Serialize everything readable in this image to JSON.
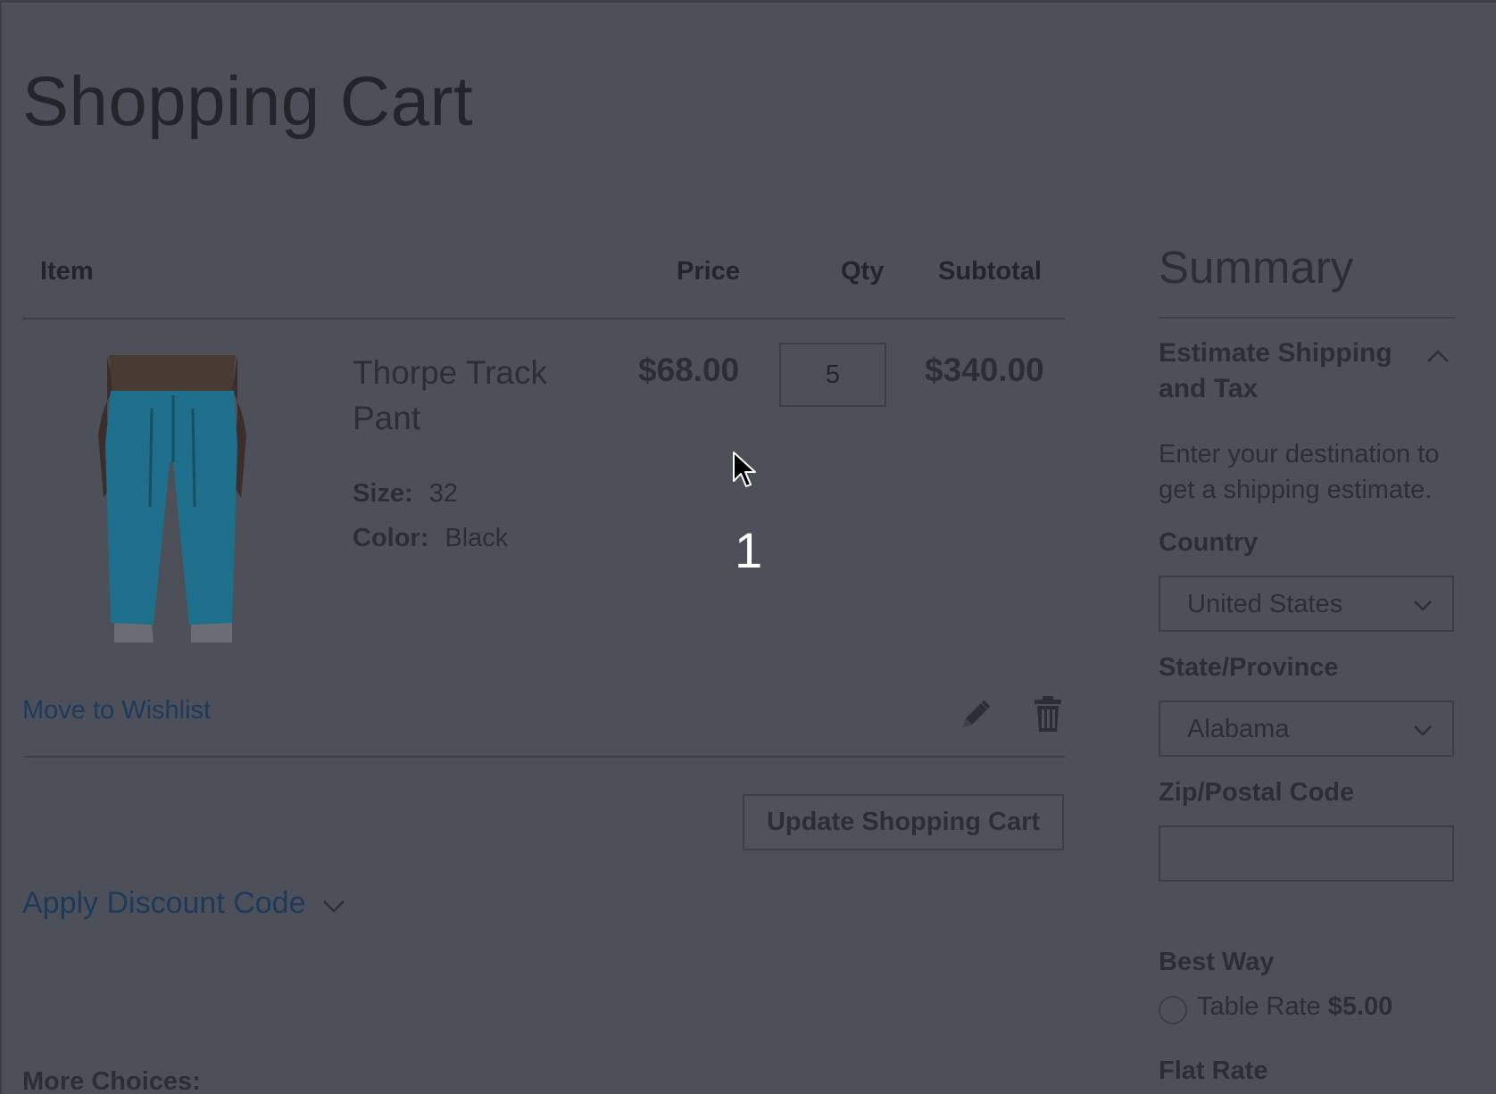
{
  "page": {
    "title": "Shopping Cart"
  },
  "cart": {
    "headers": {
      "item": "Item",
      "price": "Price",
      "qty": "Qty",
      "subtotal": "Subtotal"
    },
    "item": {
      "name": "Thorpe Track Pant",
      "options": [
        {
          "label": "Size:",
          "value": "32"
        },
        {
          "label": "Color:",
          "value": "Black"
        }
      ],
      "price": "$68.00",
      "qty": "5",
      "subtotal": "$340.00",
      "wishlist_label": "Move to Wishlist"
    },
    "update_button": "Update Shopping Cart",
    "discount_label": "Apply Discount Code",
    "more_choices": "More Choices:"
  },
  "overlay": {
    "step_number": "1"
  },
  "summary": {
    "title": "Summary",
    "estimate_heading": "Estimate Shipping and Tax",
    "estimate_desc": "Enter your destination to get a shipping estimate.",
    "country": {
      "label": "Country",
      "value": "United States"
    },
    "state": {
      "label": "State/Province",
      "value": "Alabama"
    },
    "zip": {
      "label": "Zip/Postal Code",
      "value": ""
    },
    "best_way": "Best Way",
    "table_rate_label": "Table Rate",
    "table_rate_price": "$5.00",
    "flat_rate": "Flat Rate"
  },
  "icons": {
    "edit": "pencil-icon",
    "delete": "trash-icon",
    "expand": "chevron-down-icon",
    "collapse": "chevron-up-icon"
  },
  "colors": {
    "overlay_bg": "#4d5059",
    "link": "#1c3a5c",
    "product": "#1e6f8c"
  }
}
